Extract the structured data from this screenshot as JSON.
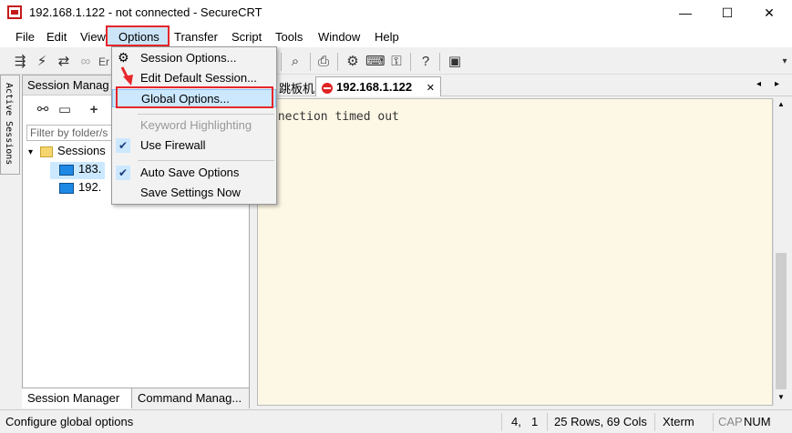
{
  "window": {
    "title": "192.168.1.122 - not connected - SecureCRT",
    "minimize": "—",
    "maximize": "☐",
    "close": "✕"
  },
  "menu": {
    "items": [
      "File",
      "Edit",
      "View",
      "Options",
      "Transfer",
      "Script",
      "Tools",
      "Window",
      "Help"
    ]
  },
  "toolbar": {
    "partial_label": "Er"
  },
  "options_menu": {
    "items": [
      {
        "label": "Session Options...",
        "checked": false,
        "disabled": false
      },
      {
        "label": "Edit Default Session...",
        "checked": false,
        "disabled": false
      },
      {
        "label": "Global Options...",
        "checked": false,
        "disabled": false,
        "highlighted": true
      },
      {
        "label": "Keyword Highlighting",
        "checked": false,
        "disabled": true
      },
      {
        "label": "Use Firewall",
        "checked": true,
        "disabled": false
      },
      {
        "label": "Auto Save Options",
        "checked": true,
        "disabled": false
      },
      {
        "label": "Save Settings Now",
        "checked": false,
        "disabled": false
      }
    ]
  },
  "session_manager": {
    "header": "Session Manag",
    "filter_placeholder": "Filter by folder/s",
    "active_sessions_label": "Active Sessions",
    "tree": {
      "folder": "Sessions",
      "items": [
        "183.",
        "192."
      ]
    },
    "tabs": [
      "Session Manager",
      "Command Manag..."
    ]
  },
  "terminal": {
    "tabs": [
      {
        "label": "跳板机",
        "active": false
      },
      {
        "label": "192.168.1.122",
        "active": true
      }
    ],
    "tab_close": "✕",
    "text": "nnection timed out"
  },
  "status": {
    "message": "Configure global options",
    "cursor_row": "4,",
    "cursor_col": "1",
    "size": "25 Rows, 69 Cols",
    "term": "Xterm",
    "cap": "CAP",
    "num": "NUM"
  },
  "colors": {
    "highlight_border": "#e6262a",
    "menu_highlight": "#cce8ff",
    "terminal_bg": "#fdf7e5"
  }
}
